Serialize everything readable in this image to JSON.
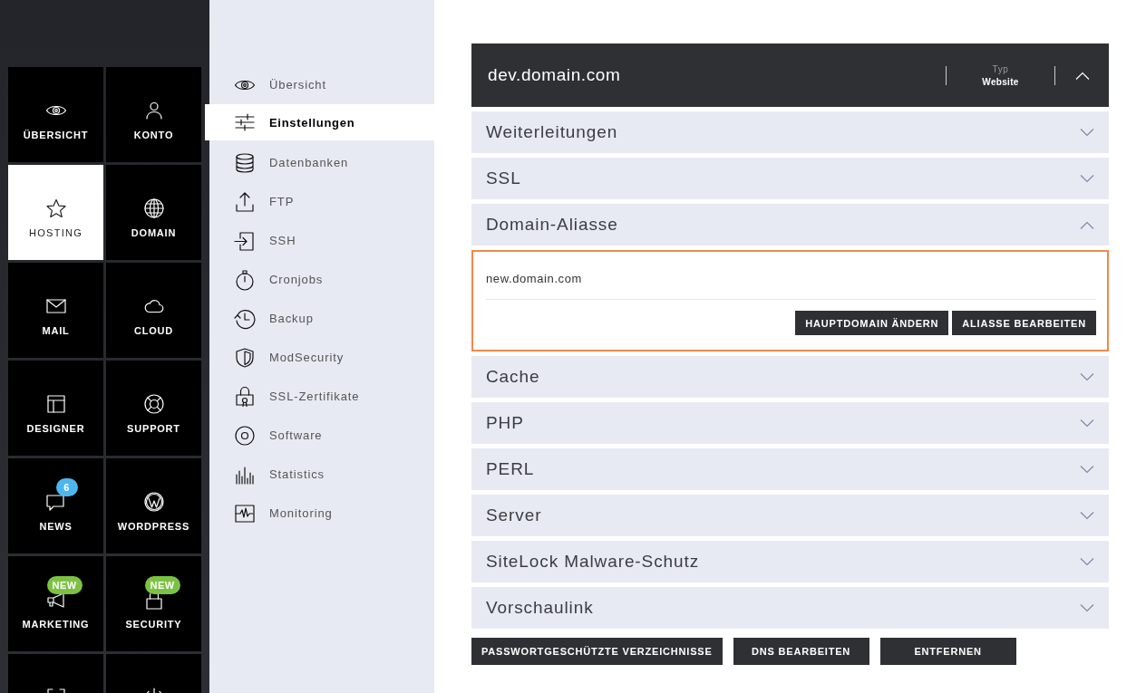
{
  "main_nav": [
    {
      "label": "ÜBERSICHT",
      "selected": false
    },
    {
      "label": "KONTO",
      "selected": false
    },
    {
      "label": "HOSTING",
      "selected": true
    },
    {
      "label": "DOMAIN",
      "selected": false
    },
    {
      "label": "MAIL",
      "selected": false
    },
    {
      "label": "CLOUD",
      "selected": false
    },
    {
      "label": "DESIGNER",
      "selected": false
    },
    {
      "label": "SUPPORT",
      "selected": false
    },
    {
      "label": "NEWS",
      "selected": false,
      "badge": {
        "text": "6",
        "color": "#4db6ee"
      }
    },
    {
      "label": "WORDPRESS",
      "selected": false
    },
    {
      "label": "MARKETING",
      "selected": false,
      "badge": {
        "text": "NEW",
        "color": "#7cc242"
      }
    },
    {
      "label": "SECURITY",
      "selected": false,
      "badge": {
        "text": "NEW",
        "color": "#7cc242"
      }
    },
    {
      "selected": false
    },
    {
      "selected": false
    }
  ],
  "sub_nav": [
    {
      "label": "Übersicht",
      "selected": false
    },
    {
      "label": "Einstellungen",
      "selected": true
    },
    {
      "label": "Datenbanken",
      "selected": false
    },
    {
      "label": "FTP",
      "selected": false
    },
    {
      "label": "SSH",
      "selected": false
    },
    {
      "label": "Cronjobs",
      "selected": false
    },
    {
      "label": "Backup",
      "selected": false
    },
    {
      "label": "ModSecurity",
      "selected": false
    },
    {
      "label": "SSL-Zertifikate",
      "selected": false
    },
    {
      "label": "Software",
      "selected": false
    },
    {
      "label": "Statistics",
      "selected": false
    },
    {
      "label": "Monitoring",
      "selected": false
    }
  ],
  "domain_panel": {
    "title": "dev.domain.com",
    "type_label": "Typ",
    "type_value": "Website",
    "expanded": true,
    "sections": [
      {
        "title": "Weiterleitungen",
        "expanded": false
      },
      {
        "title": "SSL",
        "expanded": false
      },
      {
        "title": "Domain-Aliasse",
        "expanded": true,
        "aliases": [
          "new.domain.com"
        ],
        "buttons": [
          "HAUPTDOMAIN ÄNDERN",
          "ALIASSE BEARBEITEN"
        ]
      },
      {
        "title": "Cache",
        "expanded": false
      },
      {
        "title": "PHP",
        "expanded": false
      },
      {
        "title": "PERL",
        "expanded": false
      },
      {
        "title": "Server",
        "expanded": false
      },
      {
        "title": "SiteLock Malware-Schutz",
        "expanded": false
      },
      {
        "title": "Vorschaulink",
        "expanded": false
      }
    ],
    "buttons": [
      "PASSWORTGESCHÜTZTE VERZEICHNISSE",
      "DNS BEARBEITEN",
      "ENTFERNEN"
    ]
  }
}
